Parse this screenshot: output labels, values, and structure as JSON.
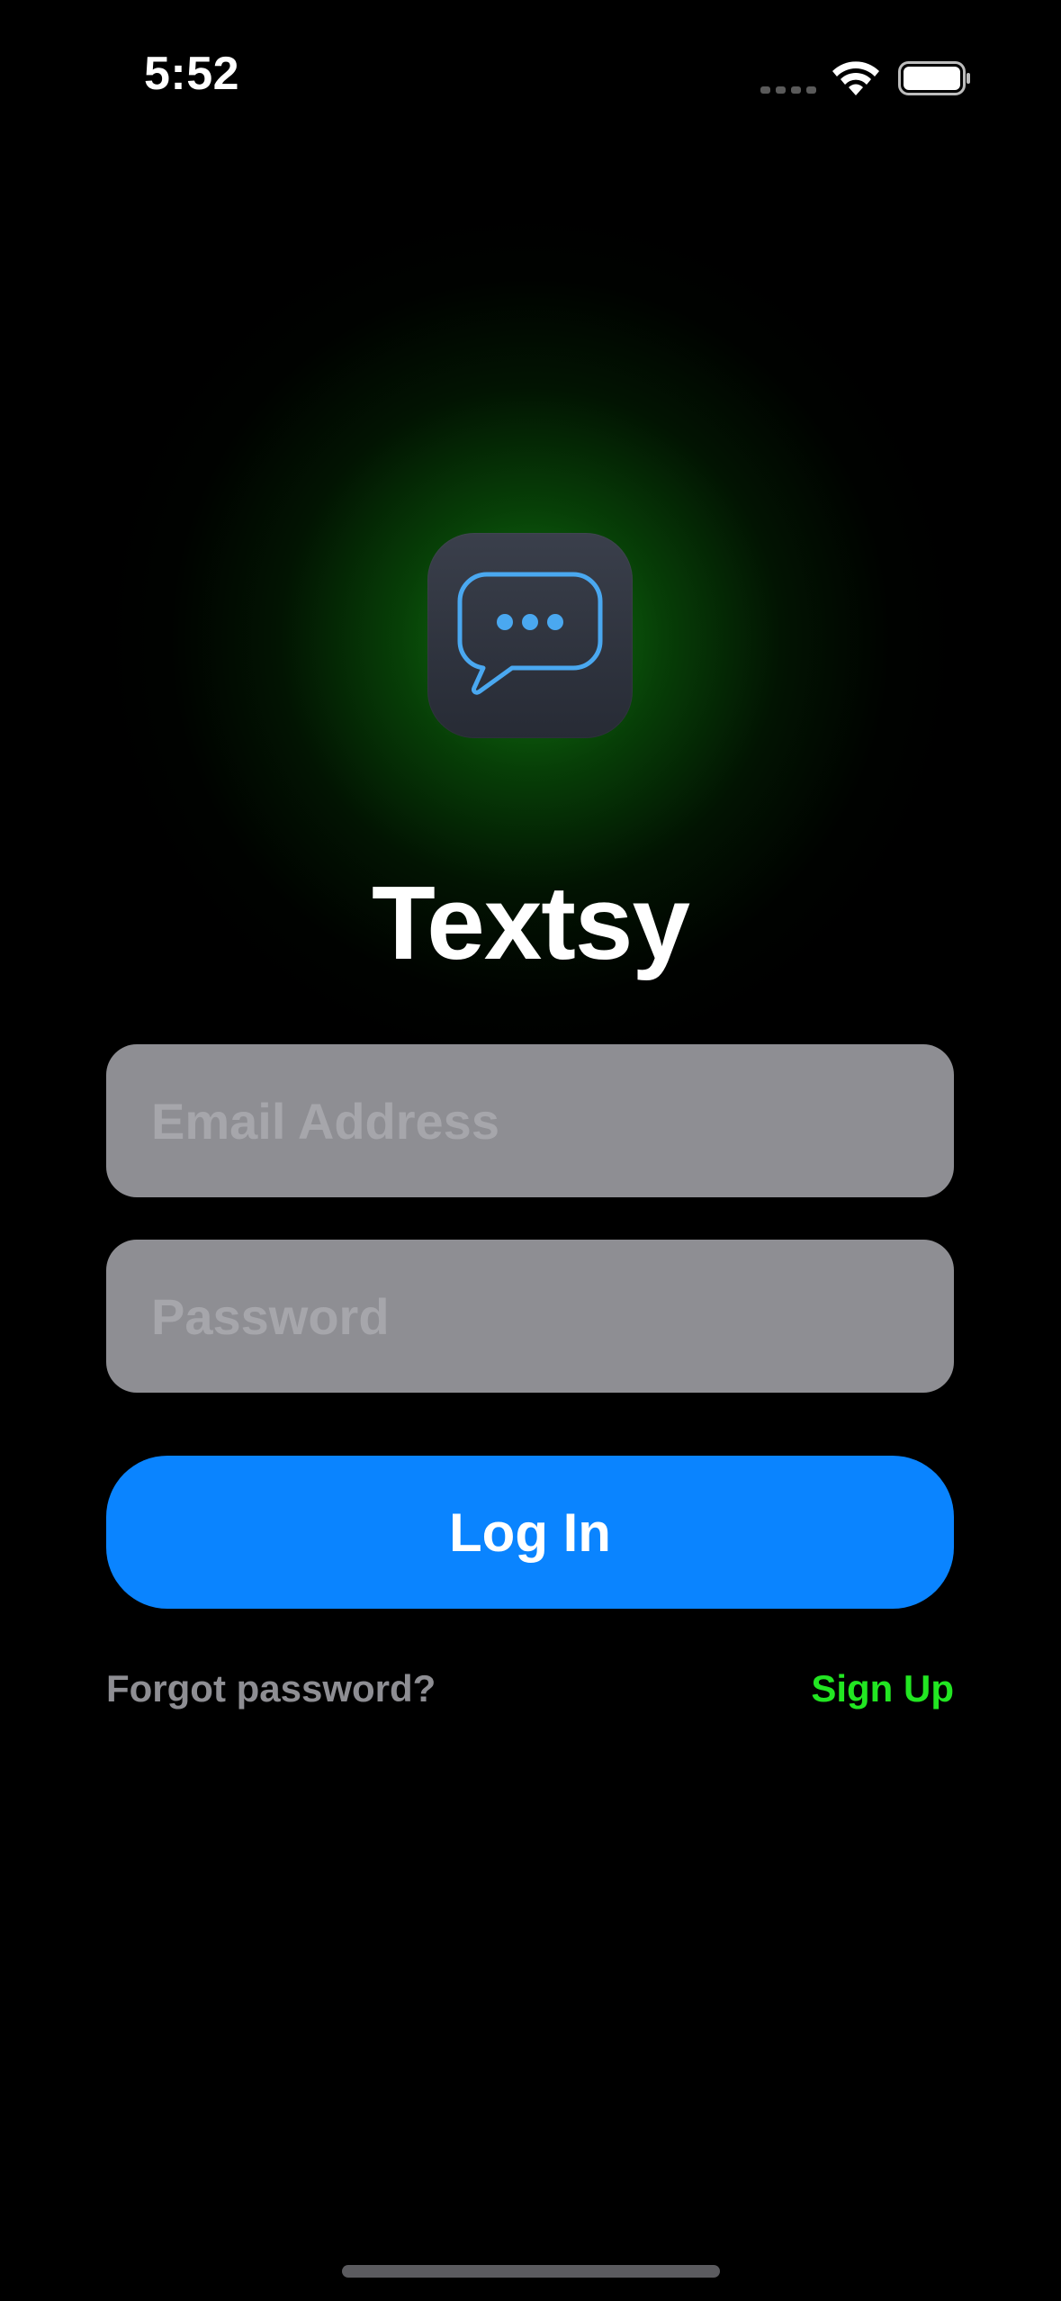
{
  "status_bar": {
    "time": "5:52",
    "icons": [
      "cellular-signal-icon",
      "wifi-icon",
      "battery-icon"
    ]
  },
  "app": {
    "logo_icon": "chat-bubble-ellipsis-icon",
    "title": "Textsy"
  },
  "login_form": {
    "email_placeholder": "Email Address",
    "password_placeholder": "Password",
    "login_label": "Log In",
    "forgot_label": "Forgot password?",
    "signup_label": "Sign Up"
  },
  "colors": {
    "background": "#000000",
    "accent_blue": "#0a84ff",
    "accent_green": "#22e622",
    "field_gray": "#8e8e93",
    "logo_stroke": "#4aa8f0"
  }
}
